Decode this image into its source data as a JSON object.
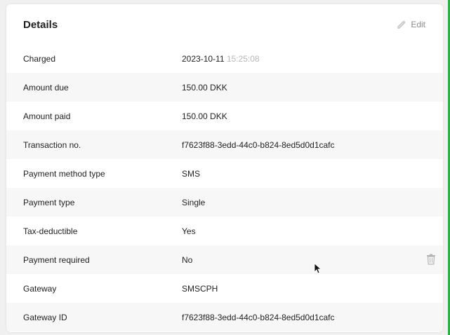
{
  "details": {
    "title": "Details",
    "edit_label": "Edit",
    "rows": [
      {
        "label": "Charged",
        "value": "2023-10-11",
        "time": "15:25:08"
      },
      {
        "label": "Amount due",
        "value": "150.00 DKK"
      },
      {
        "label": "Amount paid",
        "value": "150.00 DKK"
      },
      {
        "label": "Transaction no.",
        "value": "f7623f88-3edd-44c0-b824-8ed5d0d1cafc"
      },
      {
        "label": "Payment method type",
        "value": "SMS"
      },
      {
        "label": "Payment type",
        "value": "Single"
      },
      {
        "label": "Tax-deductible",
        "value": "Yes"
      },
      {
        "label": "Payment required",
        "value": "No"
      },
      {
        "label": "Gateway",
        "value": "SMSCPH"
      },
      {
        "label": "Gateway ID",
        "value": "f7623f88-3edd-44c0-b824-8ed5d0d1cafc"
      }
    ]
  },
  "colors": {
    "accent_edge": "#2fae47",
    "alt_row": "#f7f7f7"
  },
  "icons": {
    "edit": "pencil-icon",
    "delete": "trash-icon"
  }
}
